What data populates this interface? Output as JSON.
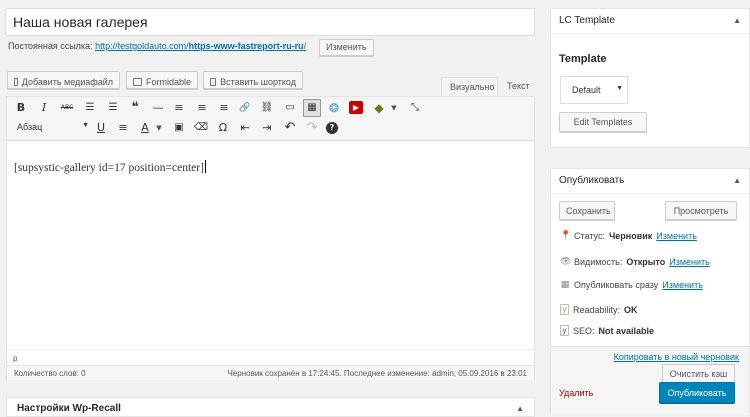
{
  "title_field": {
    "value": "Наша новая галерея"
  },
  "permalink": {
    "label": "Постоянная ссылка:",
    "url_base": "http://testgoldauto.com/",
    "url_slug": "https-www-fastreport-ru-ru",
    "url_end": "/",
    "edit_button": "Изменить"
  },
  "media_buttons": [
    {
      "label": "Добавить медиафайл",
      "icon": "media-icon"
    },
    {
      "label": "Formidable",
      "icon": "formidable-icon"
    },
    {
      "label": "Вставить шорткод",
      "icon": "shortcode-icon"
    }
  ],
  "editor_tabs": {
    "visual": "Визуально",
    "text": "Текст"
  },
  "toolbar": {
    "row1": [
      "bold-icon",
      "italic-icon",
      "strikethrough-icon",
      "bullet-list-icon",
      "numbered-list-icon",
      "blockquote-icon",
      "hr-icon",
      "align-left-icon",
      "align-center-icon",
      "align-right-icon",
      "link-icon",
      "unlink-icon",
      "read-more-icon",
      "toolbar-toggle-icon",
      "gallery-icon",
      "youtube-icon",
      "olive-plugin-icon",
      "distraction-free-icon"
    ],
    "row2": [
      "underline-icon",
      "justify-icon",
      "text-color-icon",
      "paste-text-icon",
      "clear-format-icon",
      "special-char-icon",
      "outdent-icon",
      "indent-icon",
      "undo-icon",
      "redo-icon",
      "help-icon"
    ],
    "format_select": "Абзац",
    "glyphs": {
      "bold": "B",
      "italic": "I",
      "strike": "ABC",
      "ul": "☰",
      "ol": "☰",
      "quote": "❝",
      "hr": "—",
      "al": "≡",
      "ac": "≡",
      "ar": "≡",
      "link": "🔗",
      "unlink": "⛓",
      "more": "▭",
      "kitchen": "▦",
      "gallery": "❂",
      "youtube": "▶",
      "olive": "◆",
      "dfw": "⤡",
      "underline": "U",
      "justify": "≡",
      "color": "A",
      "paste": "▣",
      "clear": "⌫",
      "omega": "Ω",
      "outdent": "⇤",
      "indent": "⇥",
      "undo": "↶",
      "redo": "↷",
      "help": "?"
    }
  },
  "editor_content": "[supsystic-gallery id=17 position=center]",
  "path_bar": "p",
  "status_bar": {
    "word_count": "Количество слов: 0",
    "saved": "Черновик сохранён в 17:24:45. Последнее изменение: admin; 05.09.2016 в 23:01"
  },
  "bottom_box": {
    "title": "Настройки Wp-Recall"
  },
  "lc_template": {
    "header": "LC Template",
    "label": "Template",
    "select_value": "Default",
    "edit_button": "Edit Templates"
  },
  "publish": {
    "header": "Опубликовать",
    "save_button": "Сохранить",
    "preview_button": "Просмотреть",
    "status_label": "Статус:",
    "status_value": "Черновик",
    "status_edit": "Изменить",
    "visibility_label": "Видимость:",
    "visibility_value": "Открыто",
    "visibility_edit": "Изменить",
    "schedule_label": "Опубликовать сразу",
    "schedule_edit": "Изменить",
    "readability_label": "Readability:",
    "readability_value": "OK",
    "seo_label": "SEO:",
    "seo_value": "Not available",
    "copy_link": "Копировать в новый черновик",
    "clear_cache": "Очистить кэш",
    "delete_link": "Удалить",
    "publish_button": "Опубликовать"
  },
  "colors": {
    "link": "#0073aa",
    "primary": "#0085ba",
    "background": "#f1f1f1"
  }
}
